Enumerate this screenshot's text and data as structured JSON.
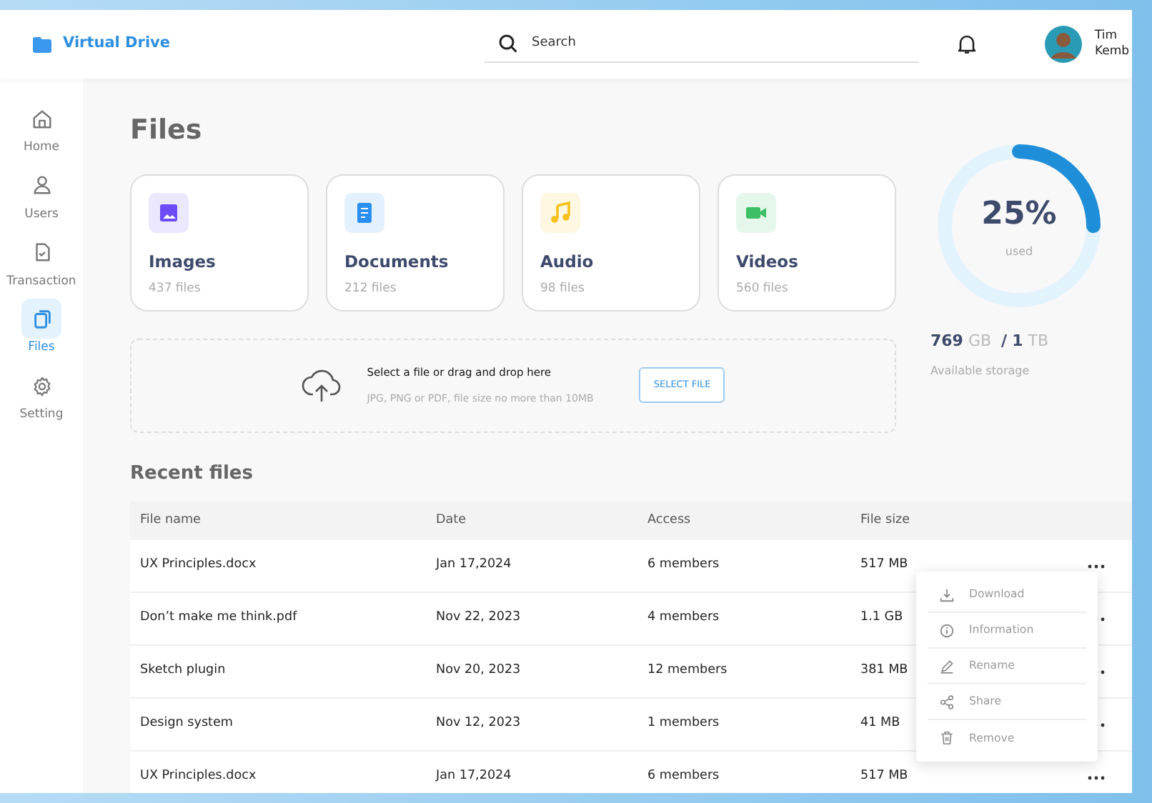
{
  "header": {
    "brand": "Virtual Drive",
    "search": {
      "placeholder": "Search"
    },
    "user": {
      "name": "Tim Kemb"
    }
  },
  "sidebar": {
    "items": [
      {
        "label": "Home",
        "selected": false
      },
      {
        "label": "Users",
        "selected": false
      },
      {
        "label": "Transaction",
        "selected": false
      },
      {
        "label": "Files",
        "selected": true
      },
      {
        "label": "Setting",
        "selected": false
      }
    ]
  },
  "page_title": "Files",
  "categories": [
    {
      "kind": "image",
      "title": "Images",
      "count": "437 files",
      "color": "#6b4cf6"
    },
    {
      "kind": "document",
      "title": "Documents",
      "count": "212 files",
      "color": "#2a8ff0"
    },
    {
      "kind": "audio",
      "title": "Audio",
      "count": "98 files",
      "color": "#f5c21b"
    },
    {
      "kind": "video",
      "title": "Videos",
      "count": "560 files",
      "color": "#3dbf64"
    }
  ],
  "upload": {
    "title": "Select a file or drag and drop here",
    "hint": "JPG, PNG or PDF, file size no more than 10MB",
    "button": "SELECT FILE"
  },
  "storage": {
    "level": 0.25,
    "percent": "25%",
    "caption": "used",
    "used": "769",
    "used_unit": "GB",
    "separator": "/",
    "total": "1",
    "total_unit": "TB",
    "label": "Available storage"
  },
  "recent": {
    "title": "Recent files",
    "columns": [
      "File name",
      "Date",
      "Access",
      "File size"
    ],
    "rows": [
      {
        "name": "UX Principles.docx",
        "date": "Jan 17,2024",
        "access": "6 members",
        "size": "517 MB"
      },
      {
        "name": "Don’t make me think.pdf",
        "date": "Nov 22, 2023",
        "access": "4 members",
        "size": "1.1 GB"
      },
      {
        "name": "Sketch plugin",
        "date": "Nov 20, 2023",
        "access": "12 members",
        "size": "381 MB"
      },
      {
        "name": "Design system",
        "date": "Nov 12, 2023",
        "access": "1 members",
        "size": "41 MB"
      },
      {
        "name": "UX Principles.docx",
        "date": "Jan 17,2024",
        "access": "6 members",
        "size": "517 MB"
      }
    ]
  },
  "context_menu": {
    "items": [
      {
        "label": "Download"
      },
      {
        "label": "Information"
      },
      {
        "label": "Rename"
      },
      {
        "label": "Share"
      },
      {
        "label": "Remove"
      }
    ]
  }
}
